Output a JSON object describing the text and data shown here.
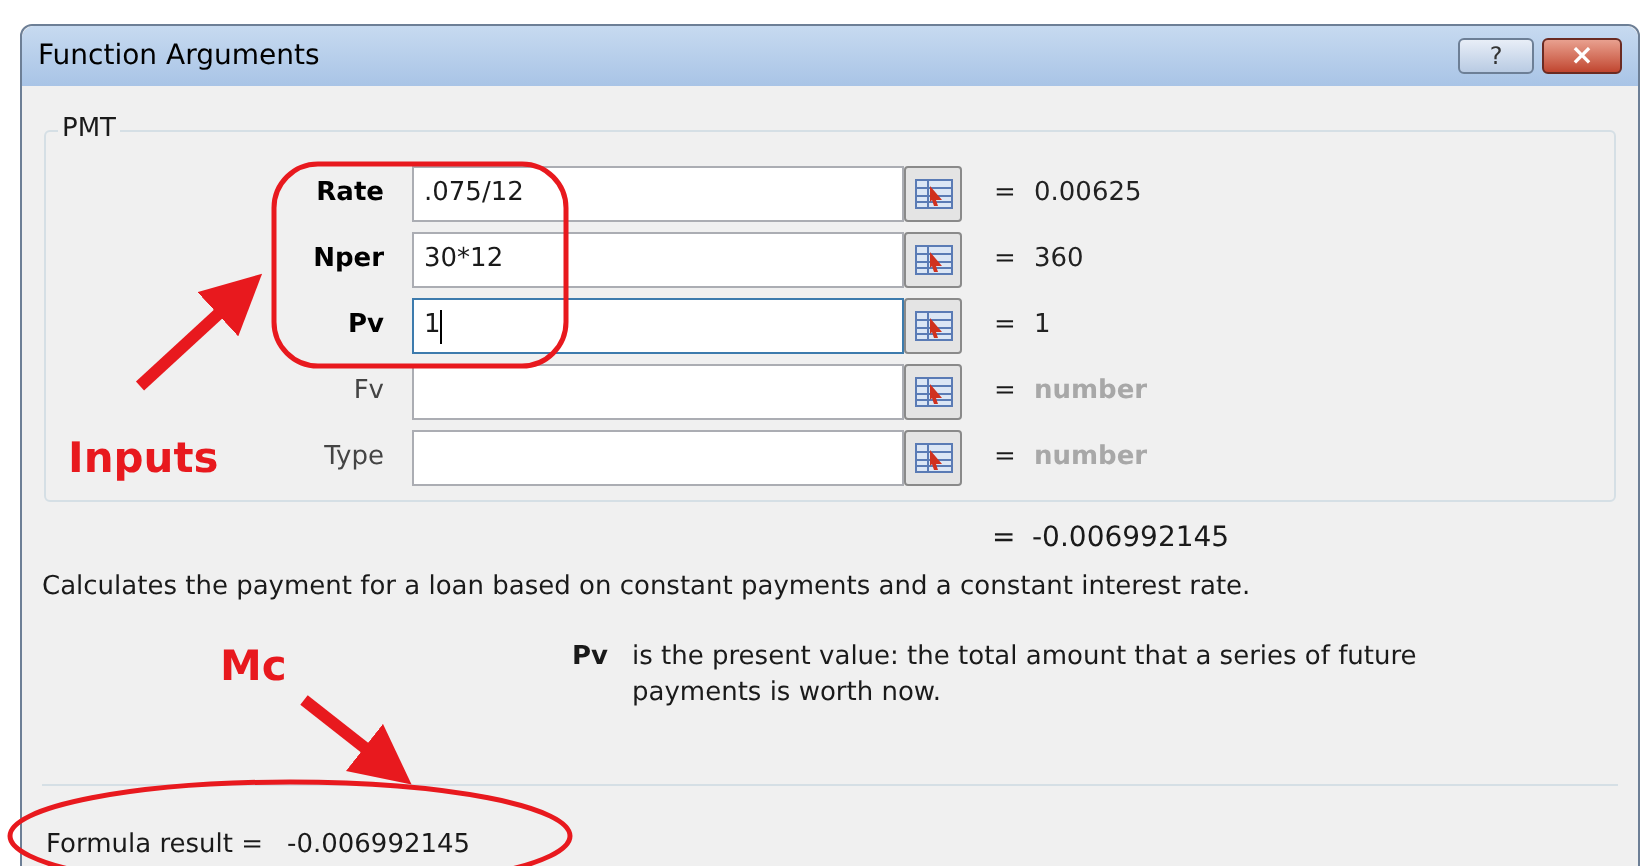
{
  "window": {
    "title": "Function Arguments",
    "buttons": [
      "?",
      "×"
    ]
  },
  "function": {
    "name": "PMT"
  },
  "arguments": [
    {
      "label": "Rate",
      "required": true,
      "value": ".075/12",
      "focused": false,
      "result": "0.00625",
      "dimmed": false
    },
    {
      "label": "Nper",
      "required": true,
      "value": "30*12",
      "focused": false,
      "result": "360",
      "dimmed": false
    },
    {
      "label": "Pv",
      "required": true,
      "value": "1",
      "focused": true,
      "result": "1",
      "dimmed": false
    },
    {
      "label": "Fv",
      "required": false,
      "focused": false,
      "result": "number",
      "dimmed": true
    },
    {
      "label": "Type",
      "required": false,
      "focused": false,
      "result": "number",
      "dimmed": true
    }
  ],
  "equals": "=",
  "overall_result": "-0.006992145",
  "description": "Calculates the payment for a loan based on constant payments and a constant interest rate.",
  "argument_help": {
    "name": "Pv",
    "text": "is the present value: the total amount that a series of future payments is worth now."
  },
  "formula_result": {
    "label": "Formula result =",
    "value": "-0.006992145"
  },
  "annotations": [
    {
      "text": "Inputs"
    },
    {
      "text": "Mc"
    }
  ]
}
